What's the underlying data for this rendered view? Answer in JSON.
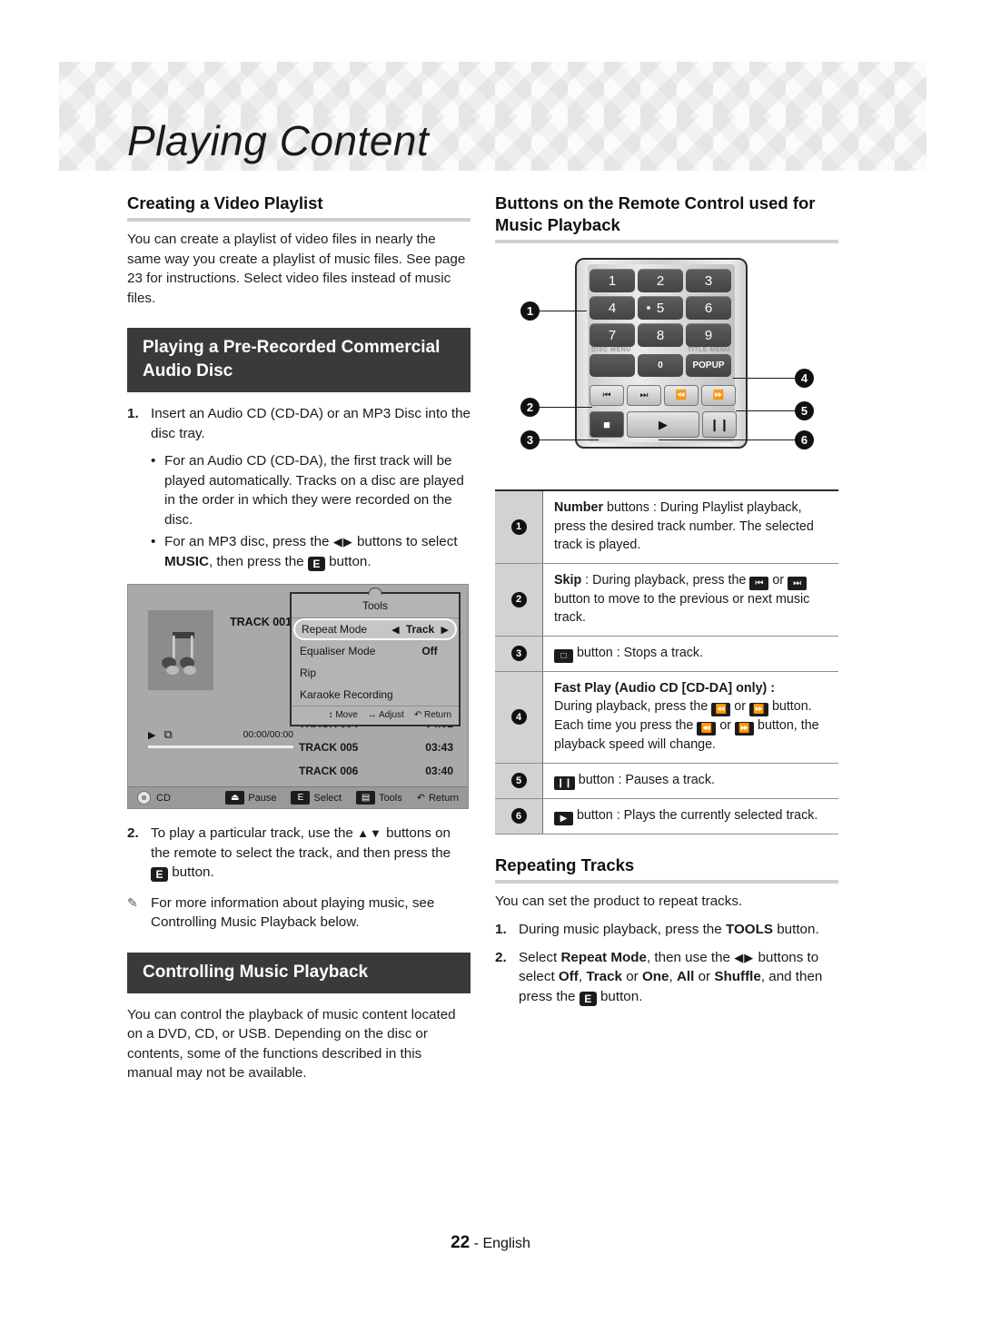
{
  "page": {
    "title": "Playing Content",
    "footer_page": "22",
    "footer_lang": "- English"
  },
  "left_column": {
    "heading_video_playlist": "Creating a Video Playlist",
    "video_playlist_body": "You can create a playlist of video files in nearly the same way you create a playlist of music files. See page 23 for instructions. Select video files instead of music files.",
    "heading_audio_disc": "Playing a Pre-Recorded Commercial Audio Disc",
    "step1_num": "1.",
    "step1_text": "Insert an Audio CD (CD-DA) or an MP3 Disc into the disc tray.",
    "bullet1": "For an Audio CD (CD-DA), the first track will be played automatically. Tracks on a disc are played in the order in which they were recorded on the disc.",
    "bullet2_part1": "For an MP3 disc, press the",
    "bullet2_arrows": "◀▶",
    "bullet2_part2": "buttons to select",
    "bullet2_bold": "MUSIC",
    "bullet2_part3": ", then press the",
    "bullet2_part4": "button.",
    "step2_num": "2.",
    "step2_part1": "To play a particular track, use the",
    "step2_arrows": "▲▼",
    "step2_part2": "buttons on the remote to select the track, and then press the",
    "step2_part3": "button.",
    "note_text": "For more information about playing music, see Controlling Music Playback below.",
    "heading_controlling": "Controlling Music Playback",
    "controlling_body": "You can control the playback of music content located on a DVD, CD, or USB. Depending on the disc or contents, some of the functions described in this manual may not be available."
  },
  "player_screen": {
    "track_label": "TRACK 001",
    "play_icon": "▶",
    "repeat_icon": "⧉",
    "time": "00:00/00:00",
    "tools_title": "Tools",
    "tools_rows": [
      {
        "label": "Repeat Mode",
        "value": "Track",
        "selected": true
      },
      {
        "label": "Equaliser Mode",
        "value": "Off",
        "selected": false
      },
      {
        "label": "Rip",
        "value": "",
        "selected": false
      },
      {
        "label": "Karaoke Recording",
        "value": "",
        "selected": false
      }
    ],
    "tools_footer": [
      {
        "icon": "↕",
        "label": "Move"
      },
      {
        "icon": "↔",
        "label": "Adjust"
      },
      {
        "icon": "↶",
        "label": "Return"
      }
    ],
    "tracks": [
      {
        "name": "TRACK 004",
        "time": "04:02"
      },
      {
        "name": "TRACK 005",
        "time": "03:43"
      },
      {
        "name": "TRACK 006",
        "time": "03:40"
      }
    ],
    "status_source": "CD",
    "status_items": [
      {
        "key": "⏏",
        "label": "Pause"
      },
      {
        "key": "E",
        "label": "Select"
      },
      {
        "key": "▤",
        "label": "Tools"
      },
      {
        "key": "↶",
        "label": "Return"
      }
    ]
  },
  "right_column": {
    "heading_remote": "Buttons on the Remote Control used for Music Playback",
    "heading_repeating": "Repeating Tracks",
    "repeating_body": "You can set the product to repeat tracks.",
    "rep_step1_num": "1.",
    "rep_step1_part1": "During music playback, press the",
    "rep_step1_bold": "TOOLS",
    "rep_step1_part2": "button.",
    "rep_step2_num": "2.",
    "rep_step2_part1": "Select",
    "rep_step2_bold1": "Repeat Mode",
    "rep_step2_part2": ", then use the",
    "rep_step2_arrows": "◀▶",
    "rep_step2_part3": "buttons to select",
    "rep_step2_opt1": "Off",
    "rep_step2_opt2": "Track",
    "rep_step2_opt3": "One",
    "rep_step2_opt4": "All",
    "rep_step2_opt5": "Shuffle",
    "rep_step2_part4": ", and then press the",
    "rep_step2_part5": "button."
  },
  "remote": {
    "number_keys": [
      "1",
      "2",
      "3",
      "4",
      "5",
      "6",
      "7",
      "8",
      "9"
    ],
    "zero_key": "0",
    "popup_key": "POPUP",
    "disc_menu_label": "DISC MENU",
    "title_menu_label": "TITLE MENU",
    "transport": [
      "⏮",
      "⏭",
      "⏪",
      "⏩"
    ],
    "stop_key": "■",
    "play_key": "▶",
    "pause_key": "❙❙",
    "callouts": [
      "1",
      "2",
      "3",
      "4",
      "5",
      "6"
    ]
  },
  "legend": {
    "rows": [
      {
        "num": "1",
        "bold_lead": "Number",
        "text": " buttons : During Playlist playback, press the desired track number. The selected track is played."
      },
      {
        "num": "2",
        "bold_lead": "Skip",
        "text_a": " : During playback, press the",
        "icon_a": "⏮",
        "text_b": "or",
        "icon_b": "⏭",
        "text_c": "button to move to the previous or next music track."
      },
      {
        "num": "3",
        "icon": "□",
        "text": "button : Stops a track."
      },
      {
        "num": "4",
        "bold_lead": "Fast Play (Audio CD [CD-DA] only) :",
        "text_a": "During playback, press the",
        "icon_a": "⏪",
        "text_b": "or",
        "icon_b": "⏩",
        "text_c": "button. Each time you press the",
        "icon_c": "⏪",
        "text_d": "or",
        "icon_d": "⏩",
        "text_e": "button, the playback speed will change."
      },
      {
        "num": "5",
        "icon": "❙❙",
        "text": "button : Pauses a track."
      },
      {
        "num": "6",
        "icon": "▶",
        "text": "button : Plays the currently selected track."
      }
    ]
  }
}
